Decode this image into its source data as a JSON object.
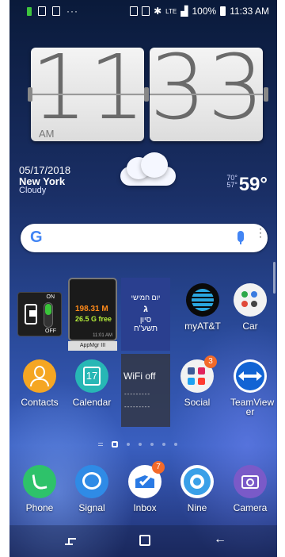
{
  "status_bar": {
    "dots": "···",
    "network": "LTE",
    "battery": "100%",
    "time": "11:33 AM",
    "icons": [
      "battery-saver-icon",
      "image-icon",
      "gallery-icon",
      "sim-icon",
      "cast-icon",
      "bluetooth-icon",
      "signal-icon",
      "battery-icon"
    ]
  },
  "clock": {
    "hours": "11",
    "minutes": "33",
    "ampm": "AM"
  },
  "weather": {
    "date": "05/17/2018",
    "city": "New York",
    "condition": "Cloudy",
    "high": "70°",
    "low": "57°",
    "temp": "59°"
  },
  "search": {
    "logo": "G",
    "icons": [
      "google-logo",
      "mic-icon",
      "more-icon"
    ]
  },
  "widgets": {
    "toggle": {
      "on": "ON",
      "off": "OFF"
    },
    "appmgr": {
      "value1": "198.31 M",
      "value2": "26.5 G free",
      "time": "11:01 AM",
      "label": "AppMgr III"
    },
    "hebcal": {
      "day": "יום חמישי",
      "letter": "ג",
      "month": "סיון",
      "year": "תשע\"ח"
    },
    "wifi": {
      "label": "WiFi off",
      "dashes1": "---------",
      "dashes2": "---------"
    }
  },
  "apps_row1": [
    {
      "label": "myAT&T",
      "color": "#0a0a0a",
      "icon": "att-icon"
    },
    {
      "label": "Car",
      "color": "#f2f2f2",
      "icon": "car-folder-icon"
    }
  ],
  "apps_row2": [
    {
      "label": "Contacts",
      "color": "#f5a623",
      "icon": "contacts-icon"
    },
    {
      "label": "Calendar",
      "color": "#27b7b5",
      "icon": "calendar-icon",
      "day": "17"
    },
    {
      "label": "Social",
      "color": "#f2f2f2",
      "icon": "social-folder-icon",
      "badge": "3"
    },
    {
      "label": "TeamView er",
      "color": "#1264d4",
      "icon": "teamviewer-icon"
    }
  ],
  "dock": [
    {
      "label": "Phone",
      "color": "#2ec26a",
      "icon": "phone-icon"
    },
    {
      "label": "Signal",
      "color": "#2f8be6",
      "icon": "signal-app-icon"
    },
    {
      "label": "Inbox",
      "color": "#ffffff",
      "icon": "inbox-icon",
      "badge": "7"
    },
    {
      "label": "Nine",
      "color": "#3aa0e8",
      "icon": "nine-icon"
    },
    {
      "label": "Camera",
      "color": "#7a5ac8",
      "icon": "camera-icon"
    }
  ]
}
